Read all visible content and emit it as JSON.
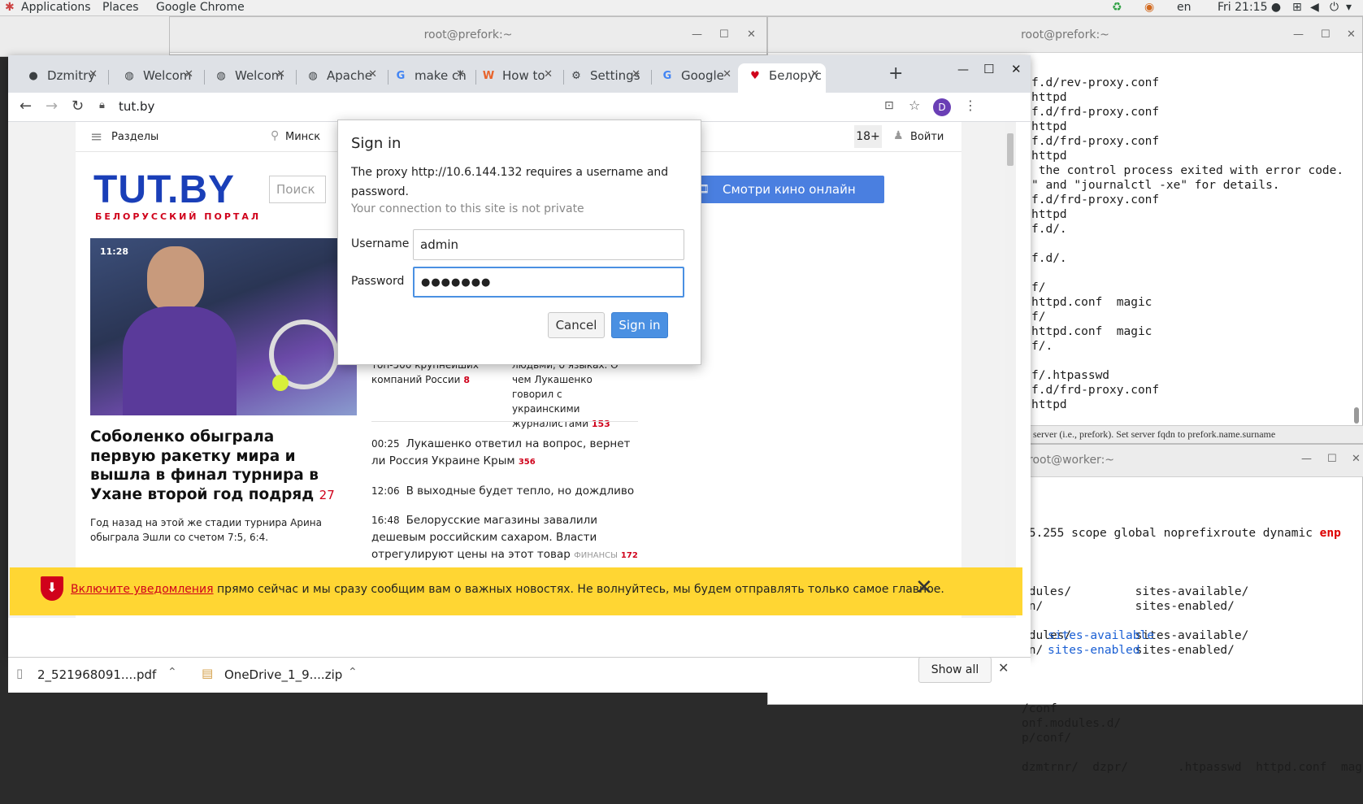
{
  "topbar": {
    "applications": "Applications",
    "places": "Places",
    "app": "Google Chrome",
    "lang": "en",
    "clock": "Fri 21:15 ●"
  },
  "terminals": {
    "t1": {
      "title": "root@prefork:~"
    },
    "t2": {
      "title": "root@prefork:~",
      "lines": [
        "f.d/rev-proxy.conf",
        "httpd",
        "f.d/frd-proxy.conf",
        "httpd",
        "f.d/frd-proxy.conf",
        "httpd",
        " the control process exited with error code.",
        "\" and \"journalctl -xe\" for details.",
        "f.d/frd-proxy.conf",
        "httpd",
        "f.d/.",
        "",
        "f.d/.",
        "",
        "f/",
        "httpd.conf  magic",
        "f/",
        "httpd.conf  magic",
        "f/.",
        "",
        "f/.htpasswd",
        "f.d/frd-proxy.conf",
        "httpd"
      ],
      "footer": "server (i.e., prefork). Set server fqdn to prefork.name.surname"
    },
    "t3": {
      "title": "root@worker:~",
      "lines": [
        "45.255 scope global noprefixroute dynamic ",
        "",
        "odules/         sites-available/",
        "un/             sites-enabled/",
        "",
        "odules/         sites-available/",
        "un/             sites-enabled/",
        "",
        "",
        "",
        "/conf",
        "onf.modules.d/",
        "p/conf/",
        "",
        "dzmtrnr/  dzpr/       .htpasswd  httpd.conf  magic"
      ],
      "red": "enp",
      "blue1": "sites-available",
      "blue2": "sites-enabled"
    }
  },
  "chrome": {
    "tabs": [
      {
        "icon": "github-icon",
        "glyph": "●",
        "label": "Dzmitry"
      },
      {
        "icon": "globe-icon",
        "glyph": "◍",
        "label": "Welcom"
      },
      {
        "icon": "globe-icon",
        "glyph": "◍",
        "label": "Welcom"
      },
      {
        "icon": "globe-icon",
        "glyph": "◍",
        "label": "Apache"
      },
      {
        "icon": "google-icon",
        "glyph": "G",
        "label": "make ch"
      },
      {
        "icon": "w-icon",
        "glyph": "W",
        "label": "How to"
      },
      {
        "icon": "gear-icon",
        "glyph": "⚙",
        "label": "Settings"
      },
      {
        "icon": "google-icon",
        "glyph": "G",
        "label": "Google"
      },
      {
        "icon": "tutby-icon",
        "glyph": "♥",
        "label": "Белорус"
      }
    ],
    "url": "tut.by",
    "profile": "D"
  },
  "site": {
    "menu": "Разделы",
    "city": "Минск",
    "age": "18+",
    "login": "Войти",
    "logo": "TUT.BY",
    "tagline": "БЕЛОРУССКИЙ ПОРТАЛ",
    "search_placeholder": "Поиск",
    "cinema": "Смотри кино онлайн",
    "main_time": "11:28",
    "main_title": "Соболенко обыграла первую ракетку мира и вышла в финал турнира в Ухане второй год подряд",
    "main_count": "27",
    "main_lead": "Год назад на этой же стадии турнира Арина обыграла Эшли со счетом 7:5, 6:4.",
    "col1_text": "получилось войти в топ-500 крупнейших компаний России",
    "col1_count": "8",
    "col2_text": "химию между людьми, о языках. О чем Лукашенко говорил с украинскими журналистами",
    "col2_count": "153",
    "news": [
      {
        "time": "00:25",
        "text": "Лукашенко ответил на вопрос, вернет ли Россия Украине Крым",
        "tag": "",
        "count": "356"
      },
      {
        "time": "12:06",
        "text": "В выходные будет тепло, но дождливо",
        "tag": "",
        "count": ""
      },
      {
        "time": "16:48",
        "text": "Белорусские магазины завалили дешевым российским сахаром. Власти отрегулируют цены на этот товар",
        "tag": "ФИНАНСЫ",
        "count": "172"
      }
    ]
  },
  "dialog": {
    "title": "Sign in",
    "message": "The proxy http://10.6.144.132 requires a username and password.",
    "sub": "Your connection to this site is not private",
    "username_label": "Username",
    "username_value": "admin",
    "password_label": "Password",
    "password_value": "●●●●●●●",
    "cancel": "Cancel",
    "signin": "Sign in"
  },
  "notification": {
    "link": "Включите уведомления",
    "text": " прямо сейчас и мы сразу сообщим вам о важных новостях. Не волнуйтесь, мы будем отправлять только самое главное."
  },
  "downloads": {
    "item1": "2_521968091....pdf",
    "item2": "OneDrive_1_9....zip",
    "show_all": "Show all"
  },
  "colors": {
    "tutby_blue": "#1a3fb8",
    "tutby_red": "#d0021b",
    "chrome_blue": "#4a90e2",
    "notif_yellow": "#ffd633"
  }
}
